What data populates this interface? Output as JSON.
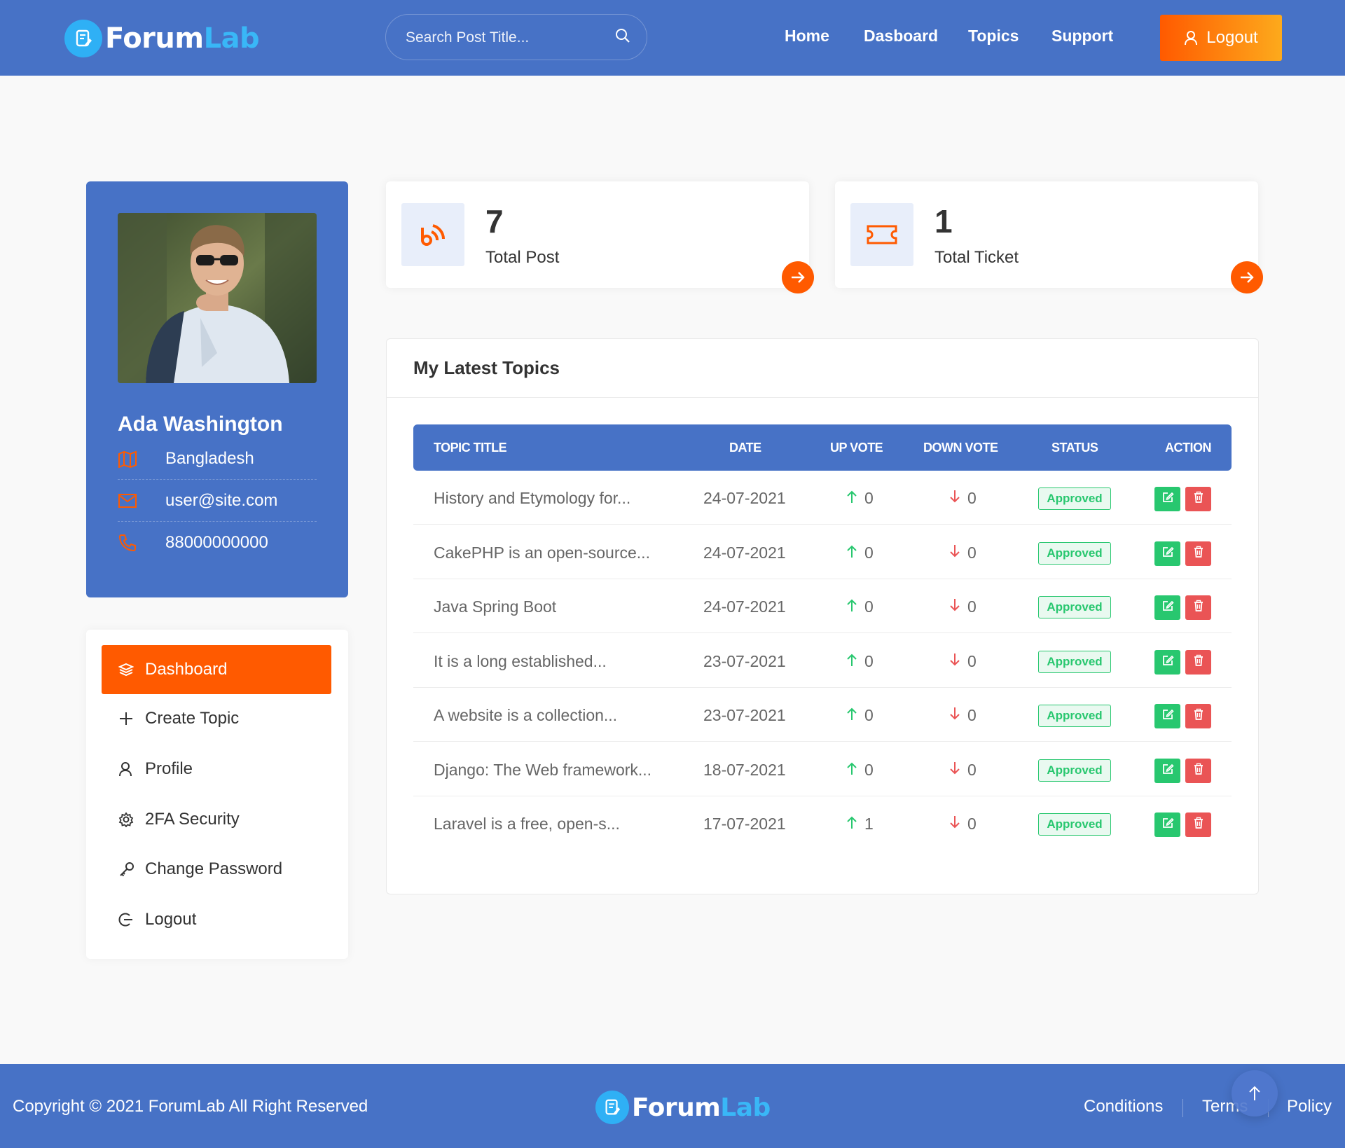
{
  "header": {
    "logo_part1": "Forum",
    "logo_part2": "Lab",
    "search_placeholder": "Search Post Title...",
    "nav": [
      "Home",
      "Dasboard",
      "Topics",
      "Support"
    ],
    "logout_label": "Logout"
  },
  "profile": {
    "name": "Ada Washington",
    "country": "Bangladesh",
    "email": "user@site.com",
    "phone": "88000000000"
  },
  "menu": {
    "items": [
      {
        "label": "Dashboard",
        "icon": "layers-icon",
        "active": true
      },
      {
        "label": "Create Topic",
        "icon": "plus-icon"
      },
      {
        "label": "Profile",
        "icon": "user-icon"
      },
      {
        "label": "2FA Security",
        "icon": "gear-icon"
      },
      {
        "label": "Change Password",
        "icon": "key-icon"
      },
      {
        "label": "Logout",
        "icon": "logout-icon"
      }
    ]
  },
  "stats": [
    {
      "value": "7",
      "label": "Total Post",
      "icon": "rss-icon"
    },
    {
      "value": "1",
      "label": "Total Ticket",
      "icon": "ticket-icon"
    }
  ],
  "topics": {
    "title": "My Latest Topics",
    "columns": [
      "TOPIC TITLE",
      "DATE",
      "UP VOTE",
      "DOWN VOTE",
      "STATUS",
      "ACTION"
    ],
    "rows": [
      {
        "title": "History and Etymology for...",
        "date": "24-07-2021",
        "up": "0",
        "down": "0",
        "status": "Approved"
      },
      {
        "title": "CakePHP is an open-source...",
        "date": "24-07-2021",
        "up": "0",
        "down": "0",
        "status": "Approved"
      },
      {
        "title": "Java Spring Boot",
        "date": "24-07-2021",
        "up": "0",
        "down": "0",
        "status": "Approved"
      },
      {
        "title": "It is a long established...",
        "date": "23-07-2021",
        "up": "0",
        "down": "0",
        "status": "Approved"
      },
      {
        "title": "A website is a collection...",
        "date": "23-07-2021",
        "up": "0",
        "down": "0",
        "status": "Approved"
      },
      {
        "title": "Django: The Web framework...",
        "date": "18-07-2021",
        "up": "0",
        "down": "0",
        "status": "Approved"
      },
      {
        "title": "Laravel is a free, open-s...",
        "date": "17-07-2021",
        "up": "1",
        "down": "0",
        "status": "Approved"
      }
    ]
  },
  "footer": {
    "copyright": "Copyright © 2021 ForumLab All Right Reserved",
    "links": [
      "Conditions",
      "Terms",
      "Policy"
    ]
  },
  "colors": {
    "primary": "#4772c6",
    "accent": "#ff5a00",
    "success": "#28c76f",
    "danger": "#ea5455"
  }
}
